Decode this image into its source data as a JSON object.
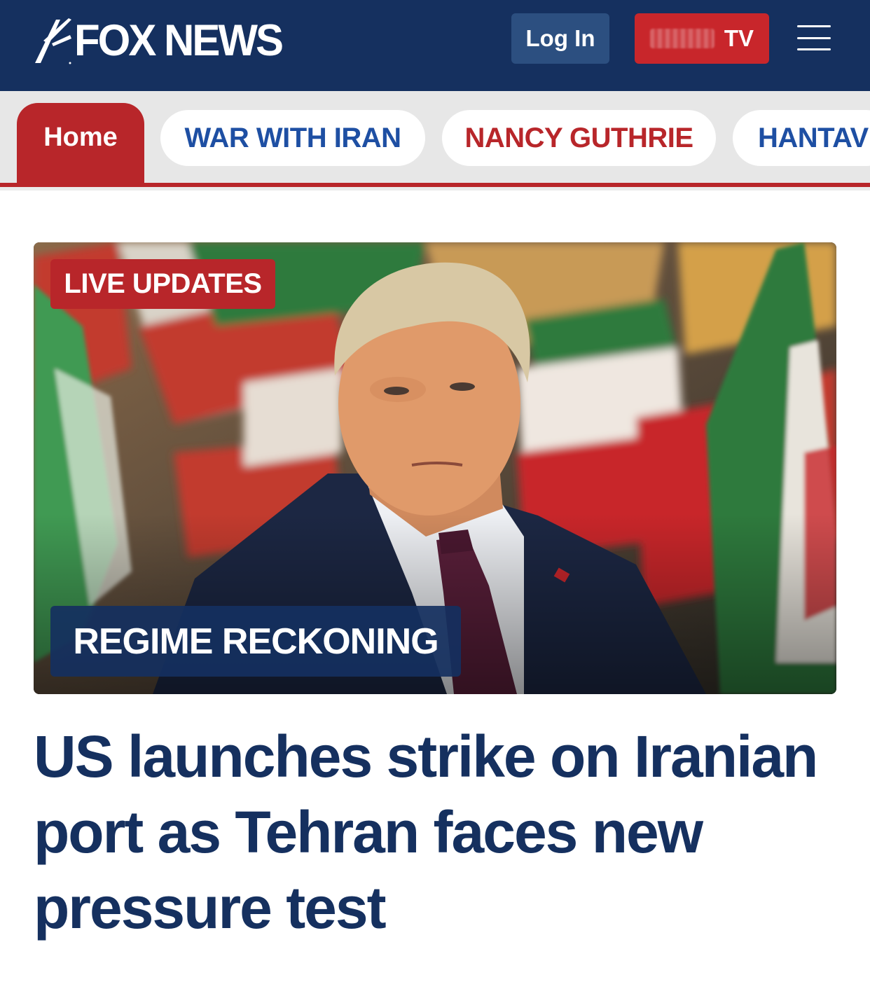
{
  "header": {
    "logo_text": "FOX NEWS",
    "login_label": "Log In",
    "tv_label": "TV",
    "menu_icon": "hamburger-menu-icon",
    "colors": {
      "header_bg": "#15305f",
      "login_bg": "#2c4f80",
      "tv_bg": "#c8262b"
    }
  },
  "nav": {
    "tabs": [
      {
        "label": "Home",
        "active": true,
        "color": "#ffffff"
      },
      {
        "label": "WAR WITH IRAN",
        "active": false,
        "color": "#1e4fa3"
      },
      {
        "label": "NANCY GUTHRIE",
        "active": false,
        "color": "#b8262a"
      },
      {
        "label": "HANTAV",
        "active": false,
        "color": "#1e4fa3"
      }
    ],
    "active_color": "#b8262a"
  },
  "hero": {
    "live_badge": "LIVE UPDATES",
    "kicker": "REGIME RECKONING"
  },
  "article": {
    "headline": "US launches strike on Iranian port as Tehran faces new pressure test"
  }
}
